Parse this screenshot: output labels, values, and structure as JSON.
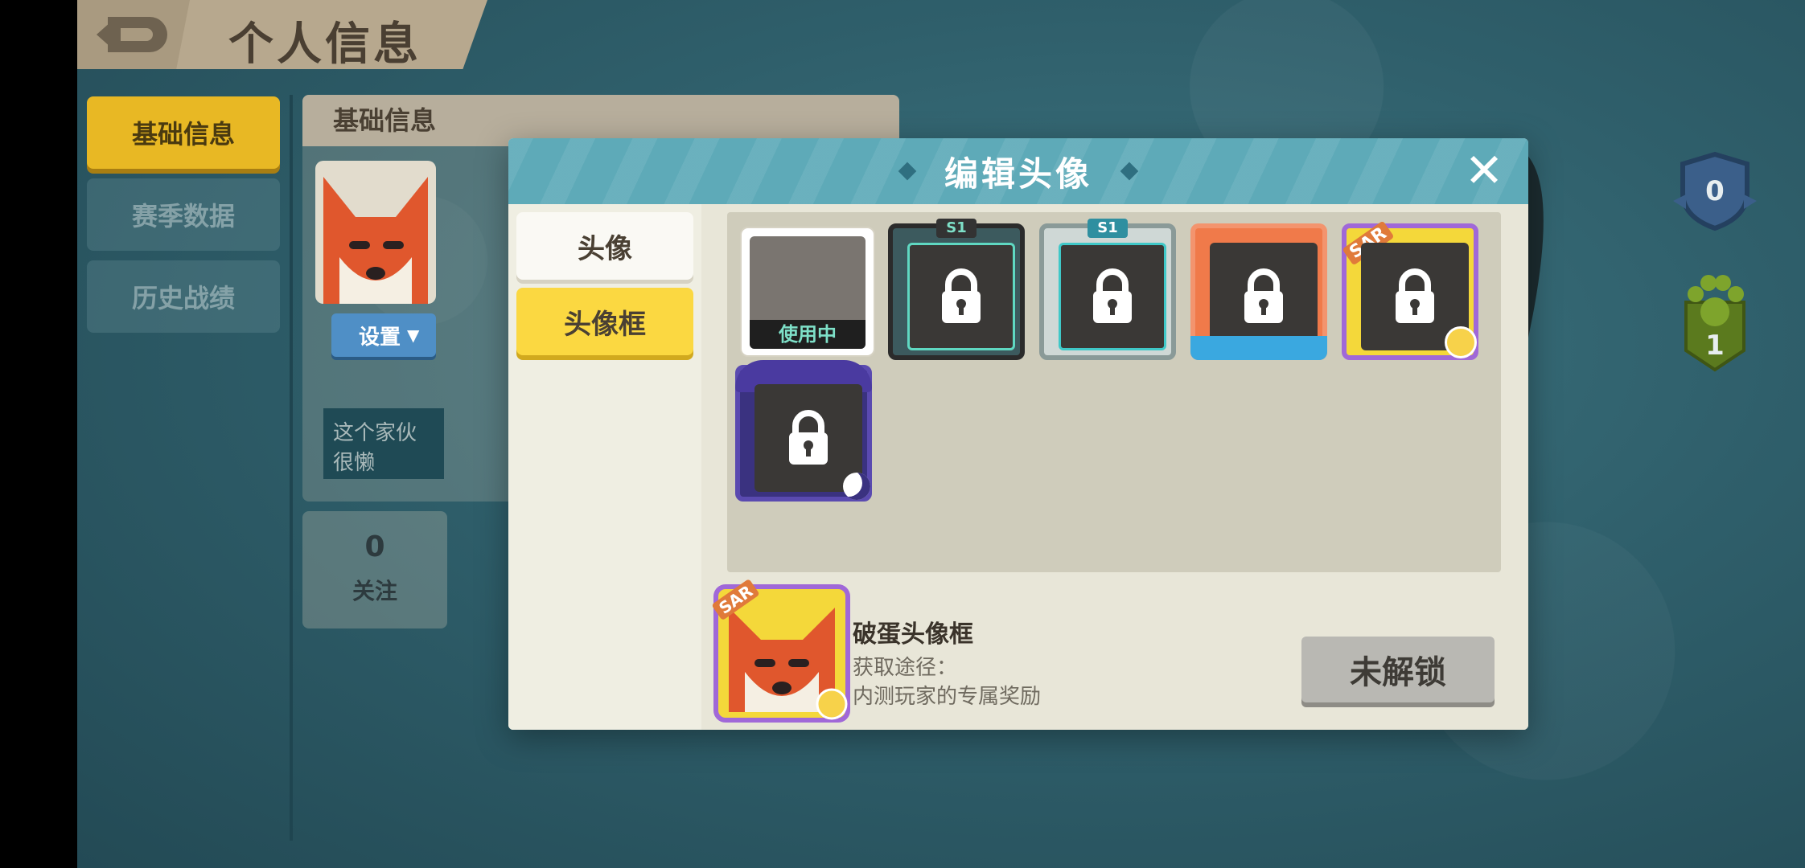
{
  "header": {
    "title": "个人信息",
    "back_icon": "back-arrow-icon"
  },
  "nav": {
    "items": [
      {
        "label": "基础信息",
        "active": true
      },
      {
        "label": "赛季数据",
        "active": false
      },
      {
        "label": "历史战绩",
        "active": false
      }
    ]
  },
  "profile": {
    "panel_title": "基础信息",
    "set_button": "设置",
    "bio_placeholder": "这个家伙很懒",
    "follow_count": "0",
    "follow_label": "关注"
  },
  "badges": {
    "shield_value": "0",
    "paw_value": "1"
  },
  "modal": {
    "title": "编辑头像",
    "tabs": [
      {
        "label": "头像",
        "active": false
      },
      {
        "label": "头像框",
        "active": true
      }
    ],
    "in_use_label": "使用中",
    "frames": [
      {
        "name": "S1",
        "locked": true,
        "color": "#3c5a5e"
      },
      {
        "name": "S1",
        "locked": true,
        "color": "#8fbfc6"
      },
      {
        "name": "orange",
        "locked": true,
        "color": "#f07a4a"
      },
      {
        "name": "SAR",
        "locked": true,
        "color": "#f4d83a"
      },
      {
        "name": "night",
        "locked": true,
        "color": "#3a3280"
      }
    ],
    "detail": {
      "title": "破蛋头像框",
      "source_label": "获取途径：",
      "source_desc": "内测玩家的专属奖励",
      "status_button": "未解锁"
    }
  },
  "colors": {
    "accent_yellow": "#fbd841",
    "modal_header": "#5eaab8",
    "background": "#2f5f6b"
  }
}
